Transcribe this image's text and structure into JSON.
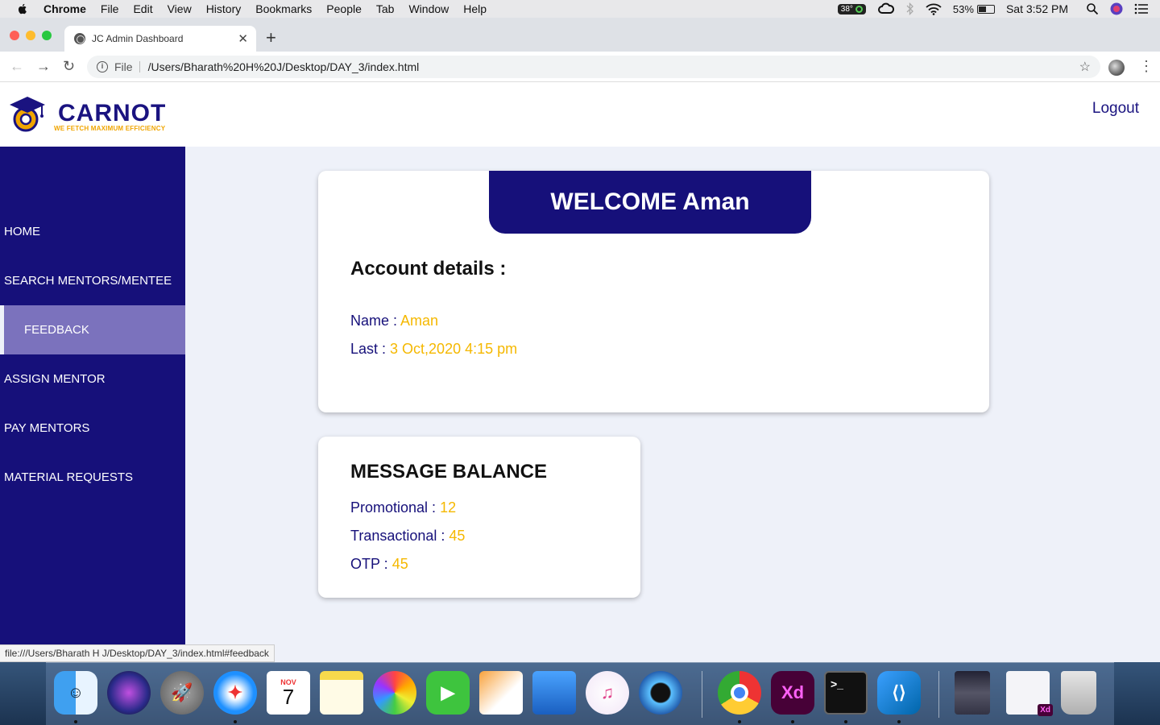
{
  "menubar": {
    "app": "Chrome",
    "items": [
      "File",
      "Edit",
      "View",
      "History",
      "Bookmarks",
      "People",
      "Tab",
      "Window",
      "Help"
    ],
    "temperature": "38°",
    "battery": "53%",
    "battery_level": 0.53,
    "clock": "Sat 3:52 PM"
  },
  "browser": {
    "tab_title": "JC Admin Dashboard",
    "url_prefix": "File",
    "url": "/Users/Bharath%20H%20J/Desktop/DAY_3/index.html",
    "status_url": "file:///Users/Bharath H J/Desktop/DAY_3/index.html#feedback"
  },
  "header": {
    "brand": "CARNOT",
    "tagline": "WE FETCH MAXIMUM EFFICIENCY",
    "logout": "Logout"
  },
  "sidebar": {
    "items": [
      {
        "label": "HOME",
        "active": false
      },
      {
        "label": "SEARCH MENTORS/MENTEE",
        "active": false
      },
      {
        "label": "FEEDBACK",
        "active": true
      },
      {
        "label": "ASSIGN MENTOR",
        "active": false
      },
      {
        "label": "PAY MENTORS",
        "active": false
      },
      {
        "label": "MATERIAL REQUESTS",
        "active": false
      }
    ]
  },
  "welcome": {
    "banner": "WELCOME Aman",
    "section_title": "Account details :",
    "name_label": "Name : ",
    "name_value": "Aman",
    "last_label": "Last : ",
    "last_value": "3 Oct,2020 4:15 pm"
  },
  "balance": {
    "title": "MESSAGE BALANCE",
    "promotional_label": "Promotional : ",
    "promotional_value": "12",
    "transactional_label": "Transactional : ",
    "transactional_value": "45",
    "otp_label": "OTP : ",
    "otp_value": "45"
  },
  "colors": {
    "primary": "#16107a",
    "accent": "#f5b800",
    "active_nav": "#7b72bd",
    "page_bg": "#eef1f9"
  },
  "dock": {
    "calendar_month": "NOV",
    "calendar_day": "7",
    "apps": [
      "finder-icon",
      "siri-icon",
      "launchpad-icon",
      "safari-icon",
      "calendar-icon",
      "notes-icon",
      "photos-icon",
      "facetime-icon",
      "pages-icon",
      "keynote-icon",
      "itunes-icon",
      "quicktime-icon",
      "chrome-icon",
      "adobe-xd-icon",
      "terminal-icon",
      "vscode-icon",
      "movie-poster-icon",
      "xd-document-icon",
      "trash-icon"
    ]
  }
}
